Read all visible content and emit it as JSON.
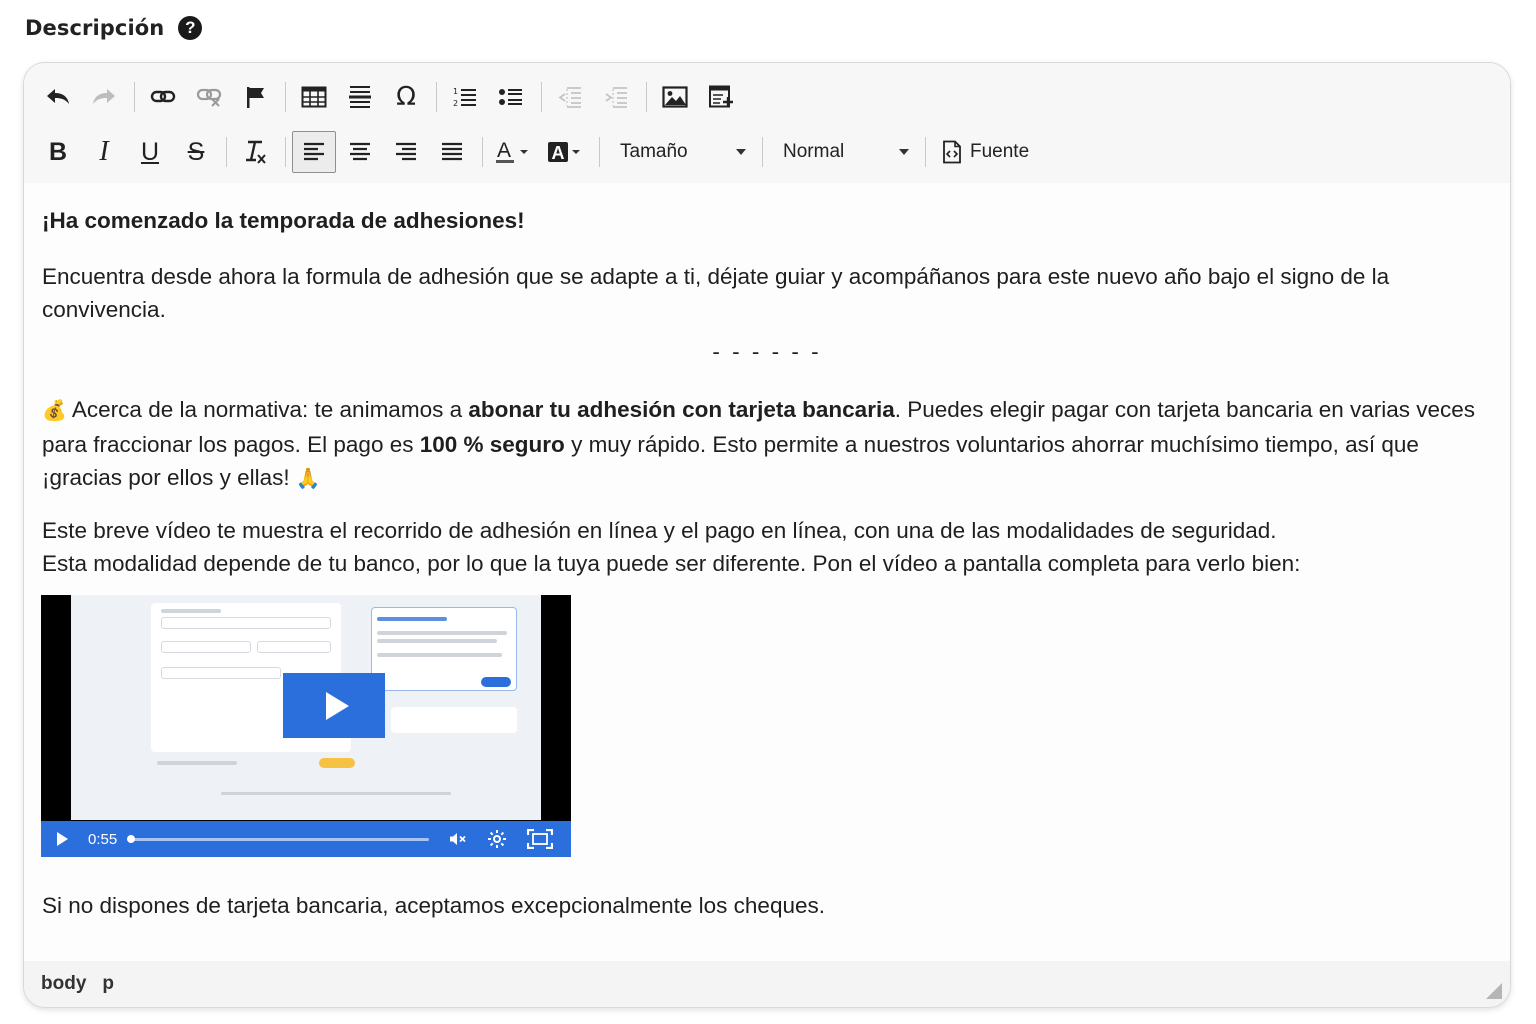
{
  "field": {
    "label": "Descripción",
    "help_icon": "?"
  },
  "toolbar": {
    "row1": [
      "undo-icon",
      "redo-icon",
      "link-icon",
      "unlink-icon",
      "anchor-flag-icon",
      "table-icon",
      "horizontal-line-icon",
      "special-char-icon",
      "numbered-list-icon",
      "bulleted-list-icon",
      "decrease-indent-icon",
      "increase-indent-icon",
      "image-icon",
      "insert-template-icon"
    ],
    "bold": "B",
    "italic": "I",
    "underline": "U",
    "strike": "S",
    "size_label": "Tamaño",
    "format_label": "Normal",
    "source_label": "Fuente"
  },
  "content": {
    "title": "¡Ha comenzado la temporada de adhesiones!",
    "intro": "Encuentra desde ahora la formula de adhesión que se adapte a ti, déjate guiar y acompáñanos para este nuevo año bajo el signo de la convivencia.",
    "separator": "- - - - - -",
    "norm_emoji": "💰",
    "norm_part1": " Acerca de la normativa: te animamos a ",
    "norm_bold1": "abonar tu adhesión con tarjeta bancaria",
    "norm_part2": ". Puedes elegir pagar con tarjeta bancaria en varias veces para fraccionar los pagos. El pago es ",
    "norm_bold2": "100 % seguro",
    "norm_part3": " y muy rápido. Esto permite a nuestros voluntarios ahorrar muchísimo tiempo, así que ¡gracias por ellos y ellas! ",
    "norm_emoji2": "🙏",
    "video_text1": "Este breve vídeo te muestra el recorrido de adhesión en línea y el pago en línea, con una de las modalidades de seguridad.",
    "video_text2": "Esta modalidad depende de tu banco, por lo que la tuya puede ser diferente. Pon el vídeo a pantalla completa para verlo bien:",
    "cheques": "Si no dispones de tarjeta bancaria, aceptamos excepcionalmente los cheques."
  },
  "video": {
    "time": "0:55",
    "progress": 0.0,
    "colors": {
      "accent": "#2b6fdc"
    }
  },
  "statusbar": {
    "path": [
      "body",
      "p"
    ]
  }
}
